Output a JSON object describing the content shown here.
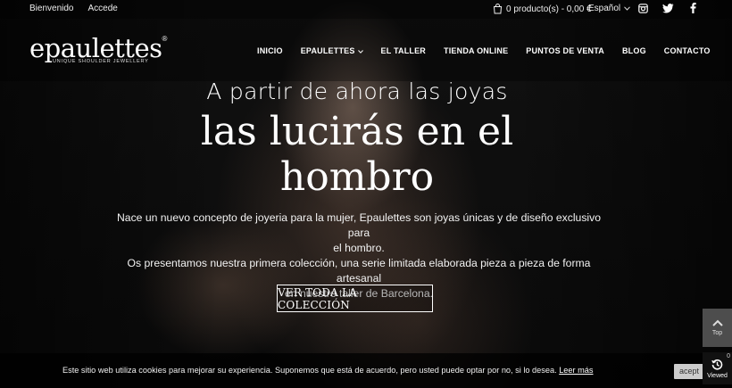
{
  "topbar": {
    "links": [
      "Bienvenido",
      "Accede"
    ],
    "cart_text": "0 producto(s) - 0,00 €",
    "language": "Español",
    "social_icons": [
      "instagram-icon",
      "twitter-icon",
      "facebook-icon"
    ]
  },
  "header": {
    "logo_text": "epaulettes",
    "logo_reg": "®",
    "logo_tagline": "UNIQUE SHOULDER JEWELLERY",
    "nav": [
      {
        "label": "INICIO"
      },
      {
        "label": "EPAULETTES"
      },
      {
        "label": "EL TALLER"
      },
      {
        "label": "TIENDA ONLINE"
      },
      {
        "label": "PUNTOS DE VENTA"
      },
      {
        "label": "BLOG"
      },
      {
        "label": "CONTACTO"
      }
    ]
  },
  "hero": {
    "subtitle": "A partir de ahora las joyas",
    "title_line1": "las lucirás en el",
    "title_line2": "hombro",
    "body_line1": "Nace un nuevo concepto de joyeria para la mujer, Epaulettes son joyas únicas y de diseño exclusivo para",
    "body_line2": "el hombro.",
    "body_line3": "Os presentamos nuestra primera colección, una serie limitada elaborada pieza a pieza de forma artesanal",
    "body_line4": "en nuestro taller de Barcelona.",
    "cta": "VER TODA LA COLECCIÓN"
  },
  "cookie": {
    "message": "Este sitio web utiliza cookies para mejorar su experiencia. Suponemos que está de acuerdo, pero usted puede optar por no, si lo desea.",
    "link": "Leer más",
    "accept": "acept"
  },
  "widgets": {
    "top_label": "Top",
    "viewed_label": "Viewed",
    "viewed_count": "0"
  }
}
